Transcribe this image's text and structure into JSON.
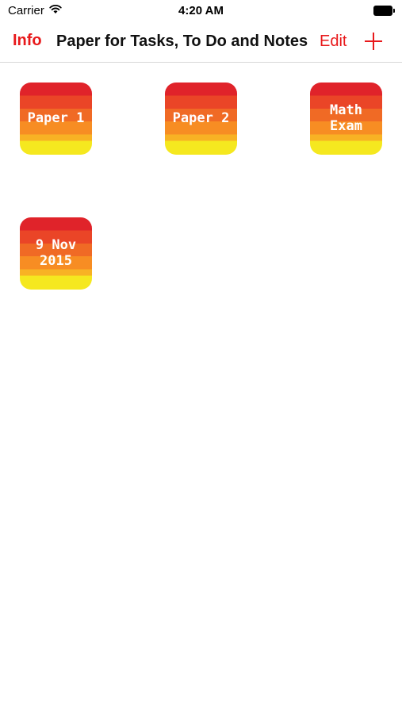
{
  "status_bar": {
    "carrier": "Carrier",
    "time": "4:20 AM",
    "wifi_icon": "wifi-icon",
    "battery_icon": "battery-icon"
  },
  "nav": {
    "info_label": "Info",
    "title": "Paper for Tasks, To Do and Notes",
    "edit_label": "Edit",
    "add_icon": "plus-icon",
    "accent_color": "#e8191b"
  },
  "papers": [
    {
      "label": "Paper 1"
    },
    {
      "label": "Paper 2"
    },
    {
      "label": "Math\nExam"
    },
    {
      "label": "9 Nov\n2015"
    }
  ],
  "colors": {
    "stripes": [
      "#e0232a",
      "#ea4527",
      "#f06a25",
      "#f78d23",
      "#f8b224",
      "#f5e81f"
    ],
    "background": "#ffffff"
  }
}
